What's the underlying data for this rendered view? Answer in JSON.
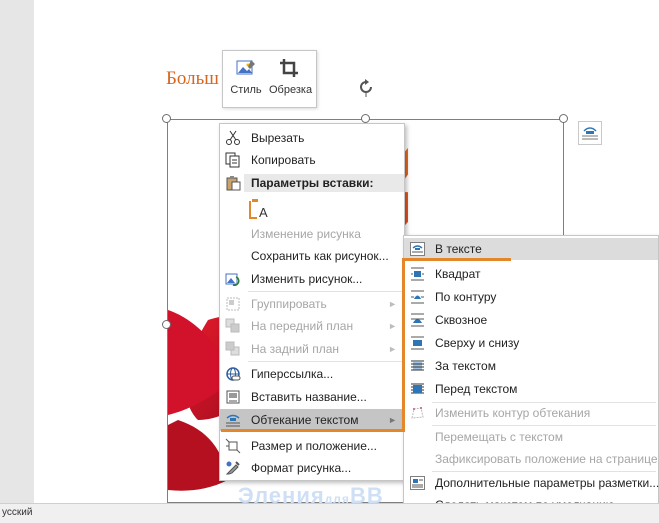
{
  "document": {
    "heading_fragment": "Больш",
    "status_language": "усский"
  },
  "mini_toolbar": {
    "style_label": "Стиль",
    "crop_label": "Обрезка"
  },
  "context_menu": {
    "cut": "Вырезать",
    "copy": "Копировать",
    "paste_options_header": "Параметры вставки:",
    "change_picture_text": "Изменение рисунка",
    "save_as_picture": "Сохранить как рисунок...",
    "change_picture": "Изменить рисунок...",
    "group": "Группировать",
    "bring_forward": "На передний план",
    "send_backward": "На задний план",
    "hyperlink": "Гиперссылка...",
    "insert_caption": "Вставить название...",
    "wrap_text": "Обтекание текстом",
    "size_position": "Размер и положение...",
    "format_picture": "Формат рисунка..."
  },
  "wrap_submenu": {
    "in_line": "В тексте",
    "square": "Квадрат",
    "tight": "По контуру",
    "through": "Сквозное",
    "top_bottom": "Сверху и снизу",
    "behind_text": "За текстом",
    "in_front": "Перед текстом",
    "edit_wrap_points": "Изменить контур обтекания",
    "move_with_text": "Перемещать с текстом",
    "fix_position": "Зафиксировать положение на странице",
    "more_layout": "Дополнительные параметры разметки...",
    "set_default": "Сделать макетом по умолчанию"
  },
  "watermark": {
    "main": "Эления",
    "small": "для",
    "tail": "ВВ"
  },
  "colors": {
    "accent_orange": "#e4862a",
    "heading_orange": "#d9651c",
    "leaf_red": "#c8102e",
    "menu_hover": "#c5c5c5"
  }
}
